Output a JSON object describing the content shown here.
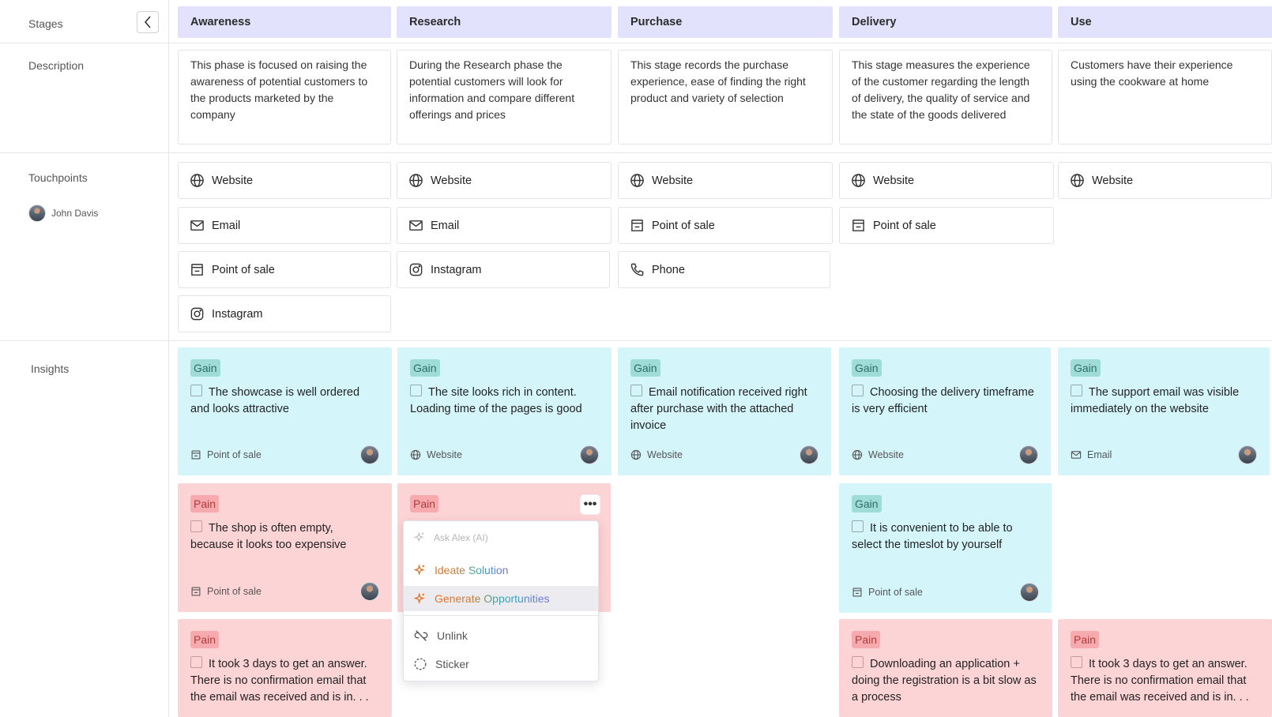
{
  "sidebar": {
    "stages_label": "Stages",
    "description_label": "Description",
    "touchpoints_label": "Touchpoints",
    "insights_label": "Insights",
    "user_name": "John Davis"
  },
  "stages": [
    {
      "name": "Awareness",
      "description": "This phase is focused on raising the awareness of potential customers to the products marketed by the company"
    },
    {
      "name": "Research",
      "description": "During the Research phase the potential customers will look for information and compare different offerings and prices"
    },
    {
      "name": "Purchase",
      "description": "This stage records the purchase experience, ease of finding the right product and variety of selection"
    },
    {
      "name": "Delivery",
      "description": "This stage measures the experience of the customer regarding the length of delivery, the quality of service and the state of the goods delivered"
    },
    {
      "name": "Use",
      "description": "Customers have their experience using the cookware at home"
    }
  ],
  "touchpoints": {
    "awareness": [
      "Website",
      "Email",
      "Point of sale",
      "Instagram"
    ],
    "research": [
      "Website",
      "Email",
      "Instagram"
    ],
    "purchase": [
      "Website",
      "Point of sale",
      "Phone"
    ],
    "delivery": [
      "Website",
      "Point of sale"
    ],
    "use": [
      "Website"
    ]
  },
  "insights": {
    "awareness": [
      {
        "type": "Gain",
        "text": "The showcase is well ordered and looks attractive",
        "touchpoint": "Point of sale"
      },
      {
        "type": "Pain",
        "text": "The shop is often empty, because it looks too expensive",
        "touchpoint": "Point of sale"
      },
      {
        "type": "Pain",
        "text": "It took 3 days to get an answer. There is no confirmation email that the email was received and is in. . ."
      }
    ],
    "research": [
      {
        "type": "Gain",
        "text": "The site looks rich in content. Loading time of the pages is good",
        "touchpoint": "Website"
      },
      {
        "type": "Pain"
      }
    ],
    "purchase": [
      {
        "type": "Gain",
        "text": "Email notification received right after purchase with the attached invoice",
        "touchpoint": "Website"
      }
    ],
    "delivery": [
      {
        "type": "Gain",
        "text": "Choosing the delivery timeframe is very efficient",
        "touchpoint": "Website"
      },
      {
        "type": "Gain",
        "text": "It is convenient to be able to select the timeslot by yourself",
        "touchpoint": "Point of sale"
      },
      {
        "type": "Pain",
        "text": "Downloading an application + doing the registration is a bit slow as a process"
      }
    ],
    "use": [
      {
        "type": "Gain",
        "text": "The support email was visible immediately on the website",
        "touchpoint": "Email"
      },
      {
        "type": "Pain",
        "text": "It took 3 days to get an answer. There is no confirmation email that the email was received and is in. . ."
      }
    ]
  },
  "context_menu": {
    "ask_ai": "Ask Alex (AI)",
    "ideate": "Ideate Solution",
    "generate": "Generate Opportunities",
    "unlink": "Unlink",
    "sticker": "Sticker"
  },
  "colors": {
    "stage_header": "#e2e2fc",
    "gain_card": "#d4f6fa",
    "pain_card": "#fdd4d6"
  }
}
